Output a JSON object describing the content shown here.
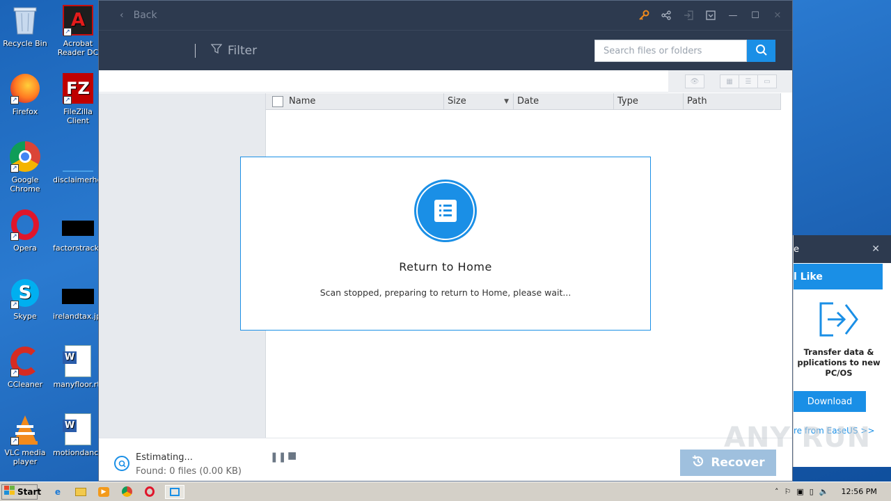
{
  "desktop": {
    "icons": [
      {
        "label": "Recycle Bin"
      },
      {
        "label": "Acrobat Reader DC"
      },
      {
        "label": "Firefox"
      },
      {
        "label": "FileZilla Client"
      },
      {
        "label": "Google Chrome"
      },
      {
        "label": "disclaimerhe..."
      },
      {
        "label": "Opera"
      },
      {
        "label": "factorstrack..."
      },
      {
        "label": "Skype"
      },
      {
        "label": "irelandtax.jpg"
      },
      {
        "label": "CCleaner"
      },
      {
        "label": "manyfloor.rtf"
      },
      {
        "label": "VLC media player"
      },
      {
        "label": "motiondance..."
      }
    ]
  },
  "app": {
    "titlebar": {
      "back_label": "Back"
    },
    "toolbar": {
      "filter_label": "Filter",
      "search_placeholder": "Search files or folders"
    },
    "table": {
      "columns": [
        "Name",
        "Size",
        "Date",
        "Type",
        "Path"
      ]
    },
    "modal": {
      "title": "Return to Home",
      "message": "Scan stopped, preparing to return to Home, please wait..."
    },
    "status": {
      "estimating": "Estimating...",
      "found": "Found: 0 files (0.00 KB)"
    },
    "recover_label": "Recover"
  },
  "promo": {
    "head": "e",
    "band": "l Like",
    "text": "Transfer data & pplications to new PC/OS",
    "download_label": "Download",
    "more_label": "re from EaseUS >>"
  },
  "taskbar": {
    "start_label": "Start",
    "clock": "12:56 PM"
  },
  "watermark": "ANY RUN",
  "colors": {
    "accent": "#1a8fe6",
    "titlebar": "#2d3a4f"
  }
}
